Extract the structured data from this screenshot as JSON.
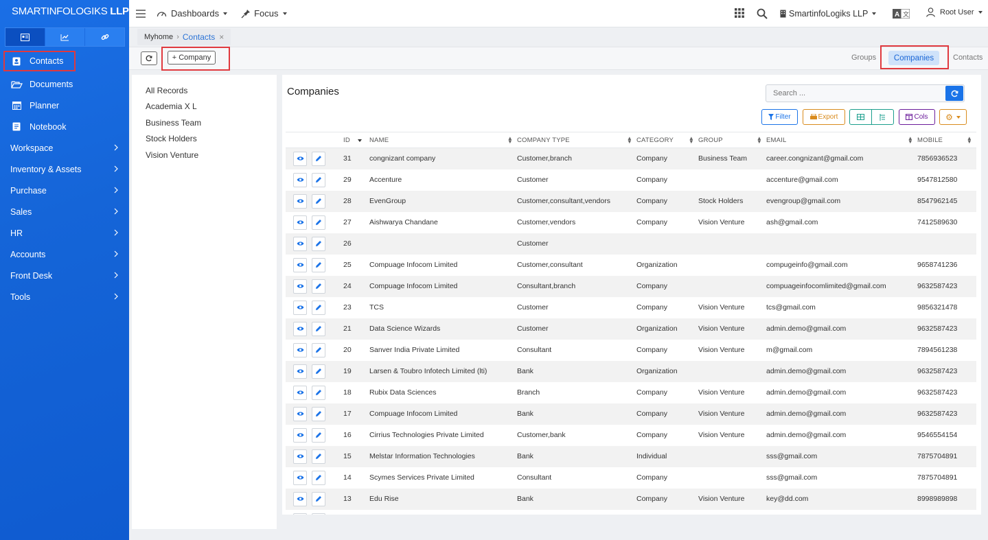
{
  "brand": {
    "name": "SMARTINFOLOGIKS",
    "suffix": "LLP"
  },
  "sidebar": {
    "tabs": [
      {
        "icon": "card-icon",
        "active": true
      },
      {
        "icon": "chart-icon",
        "active": false
      },
      {
        "icon": "link-icon",
        "active": false
      }
    ],
    "items": [
      {
        "label": "Contacts",
        "icon": "contact-card-icon",
        "highlighted": true
      },
      {
        "label": "Documents",
        "icon": "folder-open-icon"
      },
      {
        "label": "Planner",
        "icon": "calendar-icon"
      },
      {
        "label": "Notebook",
        "icon": "notebook-icon"
      },
      {
        "label": "Workspace",
        "chevron": true
      },
      {
        "label": "Inventory & Assets",
        "chevron": true
      },
      {
        "label": "Purchase",
        "chevron": true
      },
      {
        "label": "Sales",
        "chevron": true
      },
      {
        "label": "HR",
        "chevron": true
      },
      {
        "label": "Accounts",
        "chevron": true
      },
      {
        "label": "Front Desk",
        "chevron": true
      },
      {
        "label": "Tools",
        "chevron": true
      }
    ]
  },
  "topbar": {
    "dashboards": "Dashboards",
    "focus": "Focus",
    "company": "SmartinfoLogiks LLP",
    "user": "Root User"
  },
  "breadcrumb": {
    "home": "Myhome",
    "current": "Contacts",
    "close": "×"
  },
  "actions": {
    "add_company": "+ Company"
  },
  "view_tabs": {
    "groups": "Groups",
    "companies": "Companies",
    "contacts": "Contacts"
  },
  "groups": [
    "All Records",
    "Academia X L",
    "Business Team",
    "Stock Holders",
    "Vision Venture"
  ],
  "main": {
    "title": "Companies",
    "search_placeholder": "Search ...",
    "filter": "Filter",
    "export": "Export",
    "cols": "Cols"
  },
  "table": {
    "headers": {
      "id": "ID",
      "name": "NAME",
      "type": "COMPANY TYPE",
      "category": "CATEGORY",
      "group": "GROUP",
      "email": "EMAIL",
      "mobile": "MOBILE"
    },
    "rows": [
      {
        "id": "31",
        "name": "congnizant company",
        "type": "Customer,branch",
        "category": "Company",
        "group": "Business Team",
        "email": "career.congnizant@gmail.com",
        "mobile": "7856936523"
      },
      {
        "id": "29",
        "name": "Accenture",
        "type": "Customer",
        "category": "Company",
        "group": "",
        "email": "accenture@gmail.com",
        "mobile": "9547812580"
      },
      {
        "id": "28",
        "name": "EvenGroup",
        "type": "Customer,consultant,vendors",
        "category": "Company",
        "group": "Stock Holders",
        "email": "evengroup@gmail.com",
        "mobile": "8547962145"
      },
      {
        "id": "27",
        "name": "Aishwarya Chandane",
        "type": "Customer,vendors",
        "category": "Company",
        "group": "Vision Venture",
        "email": "ash@gmail.com",
        "mobile": "7412589630"
      },
      {
        "id": "26",
        "name": "",
        "type": "Customer",
        "category": "",
        "group": "",
        "email": "",
        "mobile": ""
      },
      {
        "id": "25",
        "name": "Compuage Infocom Limited",
        "type": "Customer,consultant",
        "category": "Organization",
        "group": "",
        "email": "compugeinfo@gmail.com",
        "mobile": "9658741236"
      },
      {
        "id": "24",
        "name": "Compuage Infocom Limited",
        "type": "Consultant,branch",
        "category": "Company",
        "group": "",
        "email": "compuageinfocomlimited@gmail.com",
        "mobile": "9632587423"
      },
      {
        "id": "23",
        "name": "TCS",
        "type": "Customer",
        "category": "Company",
        "group": "Vision Venture",
        "email": "tcs@gmail.com",
        "mobile": "9856321478"
      },
      {
        "id": "21",
        "name": "Data Science Wizards",
        "type": "Customer",
        "category": "Organization",
        "group": "Vision Venture",
        "email": "admin.demo@gmail.com",
        "mobile": "9632587423"
      },
      {
        "id": "20",
        "name": "Sanver India Private Limited",
        "type": "Consultant",
        "category": "Company",
        "group": "Vision Venture",
        "email": "m@gmail.com",
        "mobile": "7894561238"
      },
      {
        "id": "19",
        "name": "Larsen & Toubro Infotech Limited (lti)",
        "type": "Bank",
        "category": "Organization",
        "group": "",
        "email": "admin.demo@gmail.com",
        "mobile": "9632587423"
      },
      {
        "id": "18",
        "name": "Rubix Data Sciences",
        "type": "Branch",
        "category": "Company",
        "group": "Vision Venture",
        "email": "admin.demo@gmail.com",
        "mobile": "9632587423"
      },
      {
        "id": "17",
        "name": "Compuage Infocom Limited",
        "type": "Bank",
        "category": "Company",
        "group": "Vision Venture",
        "email": "admin.demo@gmail.com",
        "mobile": "9632587423"
      },
      {
        "id": "16",
        "name": "Cirrius Technologies Private Limited",
        "type": "Customer,bank",
        "category": "Company",
        "group": "Vision Venture",
        "email": "admin.demo@gmail.com",
        "mobile": "9546554154"
      },
      {
        "id": "15",
        "name": "Melstar Information Technologies",
        "type": "Bank",
        "category": "Individual",
        "group": "",
        "email": "sss@gmail.com",
        "mobile": "7875704891"
      },
      {
        "id": "14",
        "name": "Scymes Services Private Limited",
        "type": "Consultant",
        "category": "Company",
        "group": "",
        "email": "sss@gmail.com",
        "mobile": "7875704891"
      },
      {
        "id": "13",
        "name": "Edu Rise",
        "type": "Bank",
        "category": "Company",
        "group": "Vision Venture",
        "email": "key@dd.com",
        "mobile": "8998989898"
      },
      {
        "id": "",
        "name": "",
        "type": "",
        "category": "",
        "group": "",
        "email": "",
        "mobile": ""
      }
    ]
  },
  "colors": {
    "primary": "#1a73e8",
    "sidebar": "#1565d8",
    "highlight": "#e0393e",
    "export": "#d98b1c",
    "cols": "#6a1b9a",
    "filter": "#1a73e8",
    "table_view": "#1a9e8c"
  }
}
